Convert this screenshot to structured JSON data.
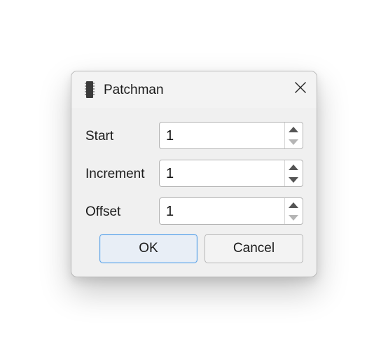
{
  "window": {
    "title": "Patchman",
    "app_icon": "chip-icon",
    "close_icon": "close-icon"
  },
  "fields": [
    {
      "label": "Start",
      "value": "1"
    },
    {
      "label": "Increment",
      "value": "1"
    },
    {
      "label": "Offset",
      "value": "1"
    }
  ],
  "buttons": {
    "ok_label": "OK",
    "cancel_label": "Cancel"
  },
  "colors": {
    "dialog_bg": "#f0f0f0",
    "ok_border": "#5aa1e6",
    "arrow_active": "#555555",
    "arrow_disabled": "#b5b5b5"
  }
}
